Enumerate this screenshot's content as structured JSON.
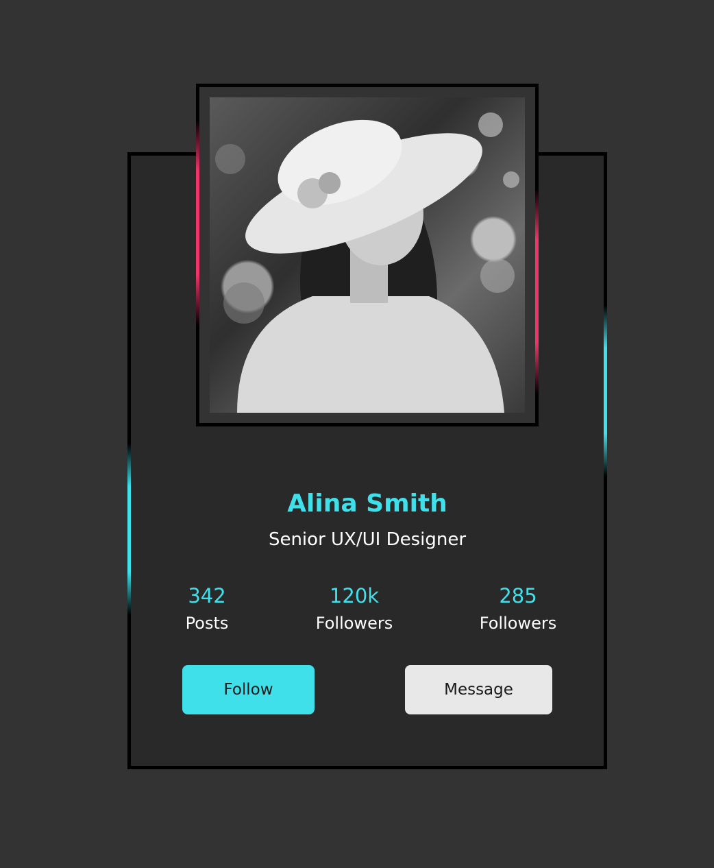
{
  "profile": {
    "name": "Alina Smith",
    "title": "Senior UX/UI Designer"
  },
  "stats": [
    {
      "value": "342",
      "label": "Posts"
    },
    {
      "value": "120k",
      "label": "Followers"
    },
    {
      "value": "285",
      "label": "Followers"
    }
  ],
  "actions": {
    "follow_label": "Follow",
    "message_label": "Message"
  },
  "colors": {
    "accent": "#3fe0ea",
    "pink_accent": "#f0356a",
    "background": "#333333",
    "card": "#292929",
    "message_button": "#e8e8e8"
  }
}
